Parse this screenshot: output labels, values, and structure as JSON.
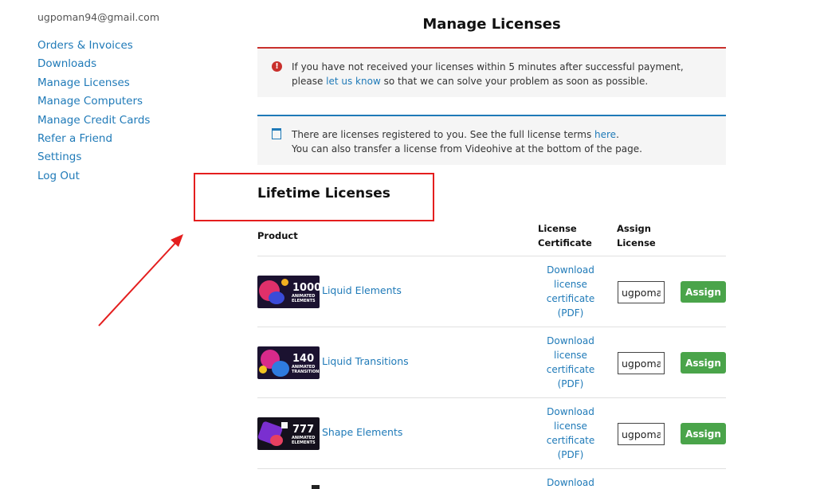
{
  "sidebar": {
    "email": "ugpoman94@gmail.com",
    "items": [
      {
        "label": "Orders & Invoices"
      },
      {
        "label": "Downloads"
      },
      {
        "label": "Manage Licenses"
      },
      {
        "label": "Manage Computers"
      },
      {
        "label": "Manage Credit Cards"
      },
      {
        "label": "Refer a Friend"
      },
      {
        "label": "Settings"
      },
      {
        "label": "Log Out"
      }
    ]
  },
  "page": {
    "title": "Manage Licenses",
    "error_notice": {
      "text_before": "If you have not received your licenses within 5 minutes after successful payment, please ",
      "link": "let us know",
      "text_after": " so that we can solve your problem as soon as possible."
    },
    "info_notice": {
      "text_before": "There are licenses registered to you. See the full license terms ",
      "link": "here",
      "text_after": ".",
      "line2": "You can also transfer a license from Videohive at the bottom of the page."
    },
    "section_title": "Lifetime Licenses"
  },
  "table": {
    "headers": {
      "product": "Product",
      "cert_line1": "License",
      "cert_line2": "Certificate",
      "assign_line1": "Assign",
      "assign_line2": "License"
    },
    "rows": [
      {
        "name": "Liquid Elements",
        "thumb_num": "1000",
        "thumb_sub": "ANIMATED ELEMENTS",
        "cert": [
          "Download",
          "license",
          "certificate",
          "(PDF)"
        ],
        "assign_value": "ugpoman",
        "assign_label": "Assign"
      },
      {
        "name": "Liquid Transitions",
        "thumb_num": "140",
        "thumb_sub": "ANIMATED TRANSITIONS",
        "cert": [
          "Download",
          "license",
          "certificate",
          "(PDF)"
        ],
        "assign_value": "ugpoman",
        "assign_label": "Assign"
      },
      {
        "name": "Shape Elements",
        "thumb_num": "777",
        "thumb_sub": "ANIMATED ELEMENTS",
        "cert": [
          "Download",
          "license",
          "certificate",
          "(PDF)"
        ],
        "assign_value": "ugpoman",
        "assign_label": "Assign"
      },
      {
        "cert": [
          "Download"
        ]
      }
    ]
  },
  "colors": {
    "link": "#1f7ab8",
    "error": "#c9302c",
    "assign_button": "#4aa44a",
    "annotation": "#e41e1e"
  }
}
